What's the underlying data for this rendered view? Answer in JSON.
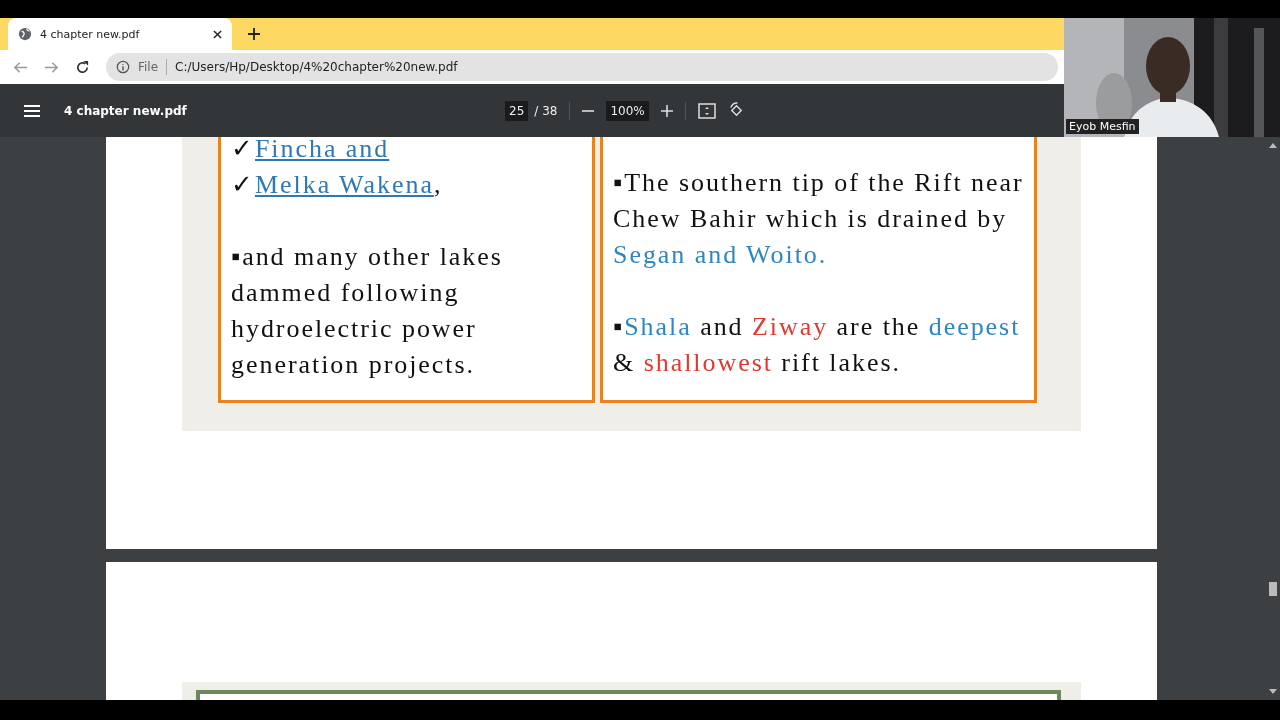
{
  "browser": {
    "tab": {
      "title": "4 chapter new.pdf",
      "selected": true
    },
    "address": {
      "scheme": "File",
      "url": "C:/Users/Hp/Desktop/4%20chapter%20new.pdf"
    }
  },
  "viewer": {
    "title": "4 chapter new.pdf",
    "page": "25",
    "page_count": "/ 38",
    "zoom": "100%"
  },
  "video": {
    "kind": "picture",
    "name": "Eyob Mesfin"
  },
  "slide": {
    "left_box": {
      "checklist": [
        {
          "mark": "✓",
          "link": "Fincha and"
        },
        {
          "mark": "✓",
          "link": "Melka Wakena",
          "after": ","
        }
      ],
      "paragraph": {
        "marker": "▪",
        "text": "and many other lakes dammed following hydroelectric power generation projects."
      }
    },
    "right_box": {
      "paragraphs": [
        {
          "marker": "▪",
          "segments": [
            {
              "text": "The southern tip of the Rift near Chew Bahir which is drained by ",
              "color": "#111111"
            },
            {
              "text": "Segan and Woito.",
              "color": "#2e86c1"
            }
          ]
        },
        {
          "marker": "▪",
          "segments": [
            {
              "text": "Shala",
              "color": "#2e86c1"
            },
            {
              "text": " and ",
              "color": "#111111"
            },
            {
              "text": "Ziway",
              "color": "#e03a30"
            },
            {
              "text": " are the ",
              "color": "#111111"
            },
            {
              "text": "deepest",
              "color": "#2e86c1"
            },
            {
              "text": " & ",
              "color": "#111111"
            },
            {
              "text": "shallowest",
              "color": "#e03a30"
            },
            {
              "text": " rift lakes.",
              "color": "#111111"
            }
          ]
        }
      ]
    }
  }
}
